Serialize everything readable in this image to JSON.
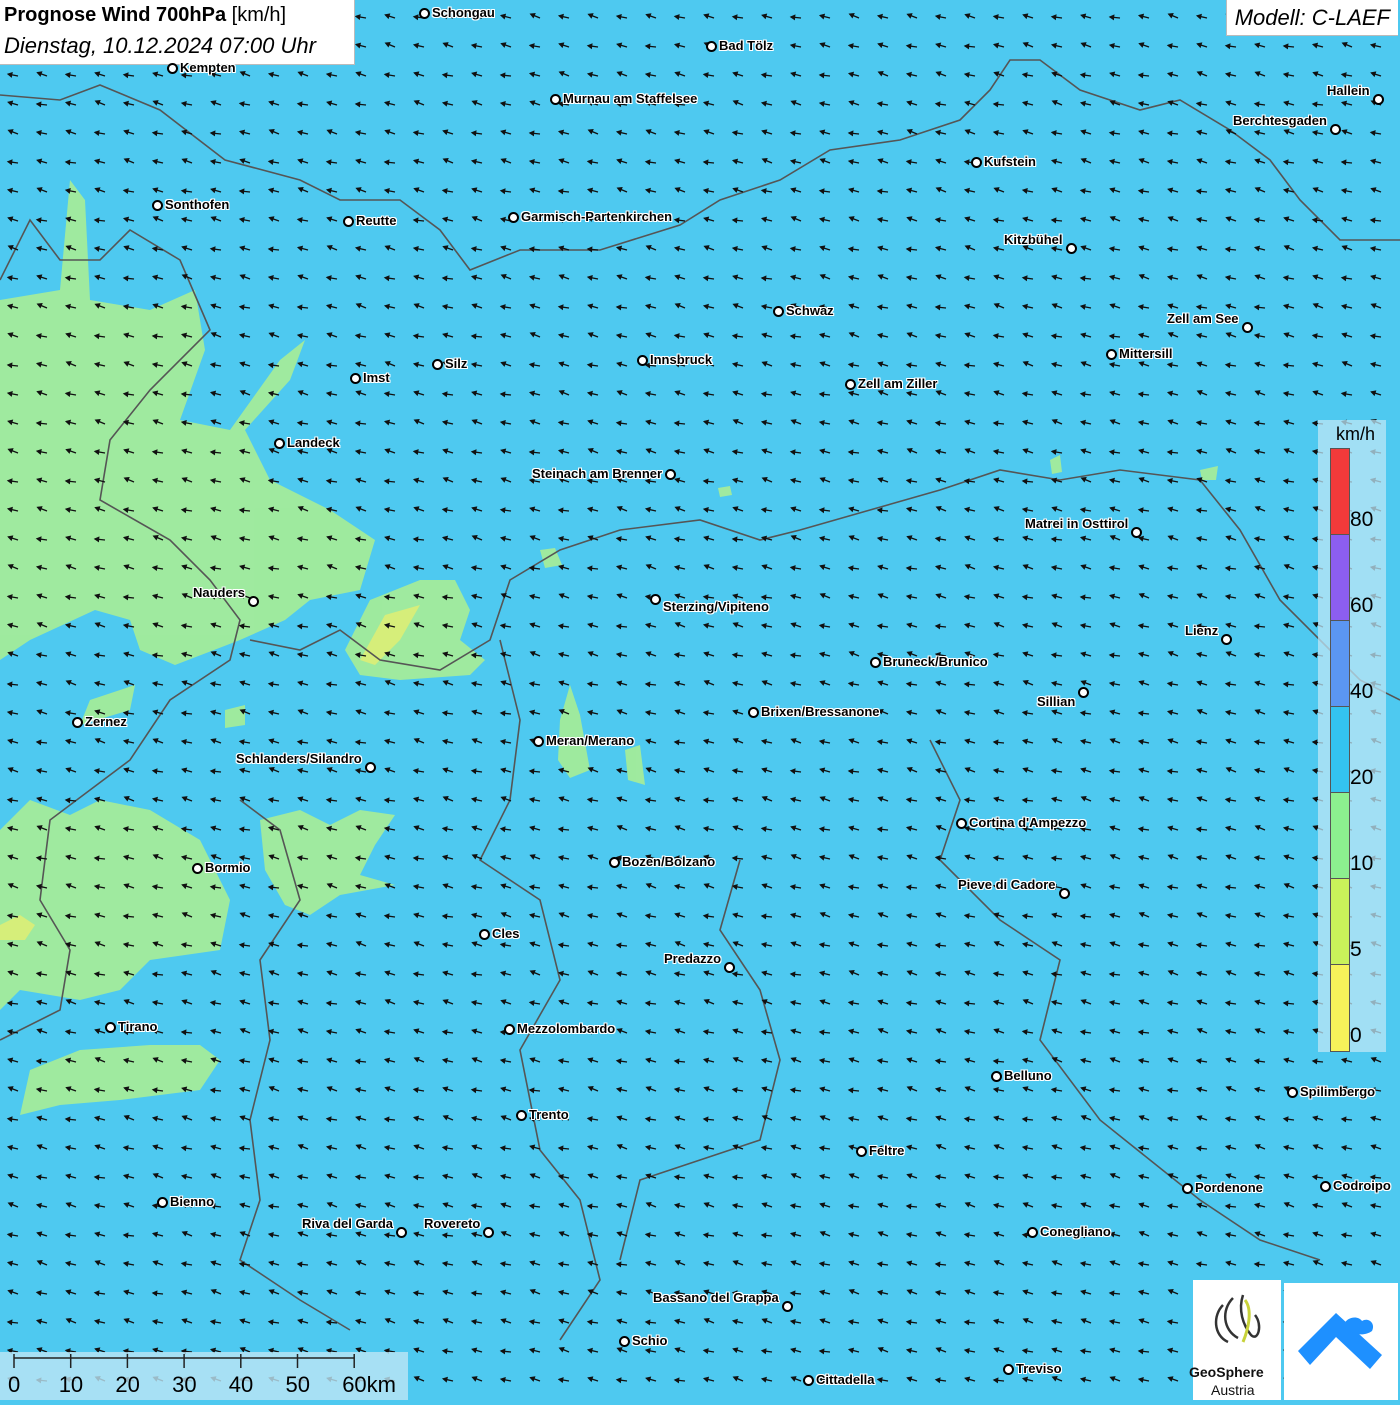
{
  "header": {
    "title_bold": "Prognose Wind 700hPa",
    "title_unit": "[km/h]",
    "datetime": "Dienstag, 10.12.2024 07:00 Uhr",
    "model": "Modell: C-LAEF"
  },
  "legend": {
    "unit": "km/h",
    "classes": [
      {
        "label": "80",
        "color": "#f23a3a"
      },
      {
        "label": "60",
        "color": "#8c5ef0"
      },
      {
        "label": "40",
        "color": "#5b96f2"
      },
      {
        "label": "20",
        "color": "#33c3f0"
      },
      {
        "label": "10",
        "color": "#8cf08f"
      },
      {
        "label": "5",
        "color": "#c9f25a"
      },
      {
        "label": "0",
        "color": "#f7f25a"
      }
    ]
  },
  "scale_bar": {
    "labels": [
      "0",
      "10",
      "20",
      "30",
      "40",
      "50",
      "60km"
    ]
  },
  "logos": {
    "geosphere_line1": "GeoSphere",
    "geosphere_line2": "Austria"
  },
  "colors": {
    "background_wind": "#4ec9f0",
    "light_wind": "#a3ec9a",
    "calm": "#e6ef70",
    "borders": "#555555",
    "arrows": "#111111"
  },
  "wind": {
    "dominant_direction": "from east (arrows pointing west)"
  },
  "cities": [
    {
      "name": "Schongau"
    },
    {
      "name": "Bad Tölz"
    },
    {
      "name": "Kempten"
    },
    {
      "name": "Murnau am Staffelsee"
    },
    {
      "name": "Hallein"
    },
    {
      "name": "Berchtesgaden"
    },
    {
      "name": "Kufstein"
    },
    {
      "name": "Sonthofen"
    },
    {
      "name": "Reutte"
    },
    {
      "name": "Garmisch-Partenkirchen"
    },
    {
      "name": "Kitzbühel"
    },
    {
      "name": "Schwaz"
    },
    {
      "name": "Zell am See"
    },
    {
      "name": "Mittersill"
    },
    {
      "name": "Innsbruck"
    },
    {
      "name": "Silz"
    },
    {
      "name": "Imst"
    },
    {
      "name": "Zell am Ziller"
    },
    {
      "name": "Landeck"
    },
    {
      "name": "Steinach am Brenner"
    },
    {
      "name": "Matrei in Osttirol"
    },
    {
      "name": "Nauders"
    },
    {
      "name": "Sterzing/Vipiteno"
    },
    {
      "name": "Lienz"
    },
    {
      "name": "Bruneck/Brunico"
    },
    {
      "name": "Sillian"
    },
    {
      "name": "Brixen/Bressanone"
    },
    {
      "name": "Zernez"
    },
    {
      "name": "Meran/Merano"
    },
    {
      "name": "Schlanders/Silandro"
    },
    {
      "name": "Cortina d'Ampezzo"
    },
    {
      "name": "Bozen/Bolzano"
    },
    {
      "name": "Bormio"
    },
    {
      "name": "Pieve di Cadore"
    },
    {
      "name": "Cles"
    },
    {
      "name": "Predazzo"
    },
    {
      "name": "Tirano"
    },
    {
      "name": "Mezzolombardo"
    },
    {
      "name": "Belluno"
    },
    {
      "name": "Spilimbergo"
    },
    {
      "name": "Trento"
    },
    {
      "name": "Feltre"
    },
    {
      "name": "Pordenone"
    },
    {
      "name": "Codroipo"
    },
    {
      "name": "Bienno"
    },
    {
      "name": "Riva del Garda"
    },
    {
      "name": "Rovereto"
    },
    {
      "name": "Conegliano"
    },
    {
      "name": "Bassano del Grappa"
    },
    {
      "name": "Schio"
    },
    {
      "name": "Treviso"
    },
    {
      "name": "Cittadella"
    }
  ]
}
